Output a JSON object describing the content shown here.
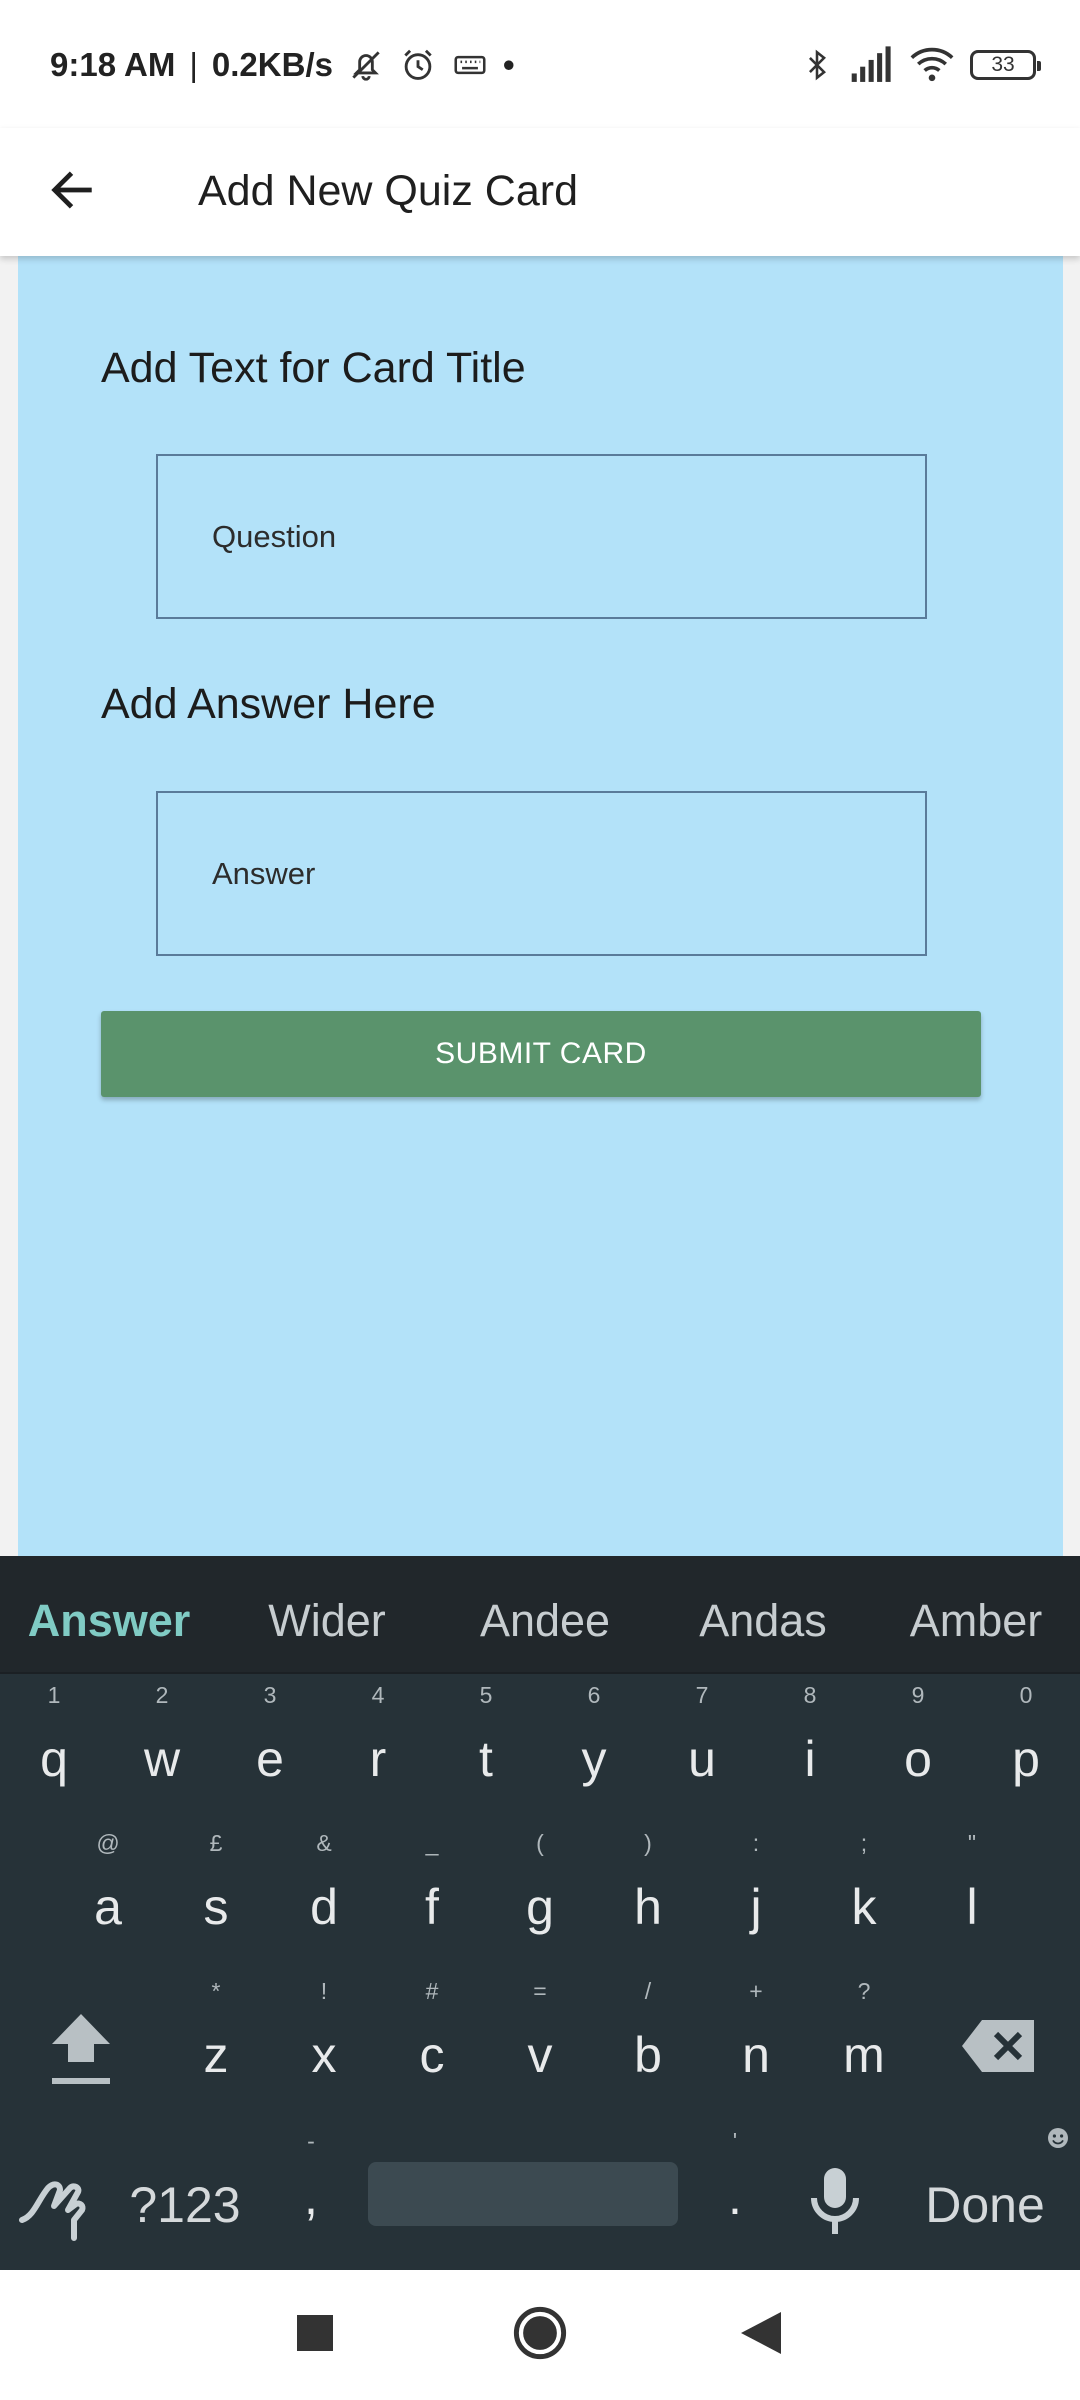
{
  "status_bar": {
    "time": "9:18 AM",
    "separator": "|",
    "net_speed": "0.2KB/s",
    "dot": "•",
    "battery": "33",
    "icons": [
      "mute-icon",
      "alarm-icon",
      "keyboard-icon",
      "bluetooth-icon",
      "signal-icon",
      "wifi-icon",
      "battery-icon"
    ]
  },
  "app_bar": {
    "title": "Add New Quiz Card",
    "back_icon": "arrow-left-icon"
  },
  "form": {
    "title_label": "Add Text for Card Title",
    "question_placeholder": "Question",
    "question_value": "",
    "answer_label": "Add Answer Here",
    "answer_placeholder": "Answer",
    "answer_value": "",
    "submit_label": "SUBMIT CARD"
  },
  "keyboard": {
    "suggestions": [
      "Answer",
      "Wider",
      "Andee",
      "Andas",
      "Amber"
    ],
    "row1": [
      {
        "hint": "1",
        "key": "q"
      },
      {
        "hint": "2",
        "key": "w"
      },
      {
        "hint": "3",
        "key": "e"
      },
      {
        "hint": "4",
        "key": "r"
      },
      {
        "hint": "5",
        "key": "t"
      },
      {
        "hint": "6",
        "key": "y"
      },
      {
        "hint": "7",
        "key": "u"
      },
      {
        "hint": "8",
        "key": "i"
      },
      {
        "hint": "9",
        "key": "o"
      },
      {
        "hint": "0",
        "key": "p"
      }
    ],
    "row2": [
      {
        "hint": "@",
        "key": "a"
      },
      {
        "hint": "£",
        "key": "s"
      },
      {
        "hint": "&",
        "key": "d"
      },
      {
        "hint": "_",
        "key": "f"
      },
      {
        "hint": "(",
        "key": "g"
      },
      {
        "hint": ")",
        "key": "h"
      },
      {
        "hint": ":",
        "key": "j"
      },
      {
        "hint": ";",
        "key": "k"
      },
      {
        "hint": "\"",
        "key": "l"
      }
    ],
    "row3": [
      {
        "hint": "*",
        "key": "z"
      },
      {
        "hint": "!",
        "key": "x"
      },
      {
        "hint": "#",
        "key": "c"
      },
      {
        "hint": "=",
        "key": "v"
      },
      {
        "hint": "/",
        "key": "b"
      },
      {
        "hint": "+",
        "key": "n"
      },
      {
        "hint": "?",
        "key": "m"
      }
    ],
    "symbols_label": "?123",
    "comma": ",",
    "comma_hint": "-",
    "period": ".",
    "period_hint": "'",
    "done_label": "Done",
    "accent": "#80cbc4"
  },
  "nav_bar": {
    "icons": [
      "recents-square-icon",
      "home-circle-icon",
      "back-triangle-icon"
    ]
  },
  "colors": {
    "content_bg": "#b3e2f9",
    "submit_bg": "#5a936c",
    "keyboard_bg": "#263238"
  }
}
